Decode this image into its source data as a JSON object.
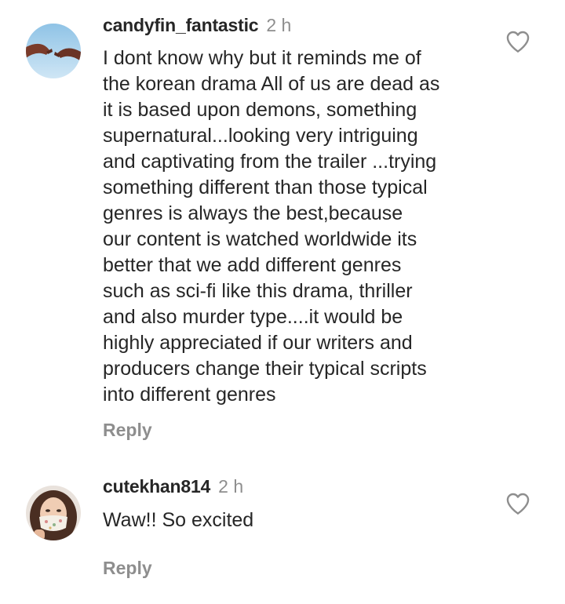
{
  "comments": [
    {
      "username": "candyfin_fantastic",
      "time": "2 h",
      "text": "I dont know why but it reminds me of\nthe korean drama All of us are dead as\nit is based upon demons, something\nsupernatural...looking very intriguing\nand captivating from the trailer ...trying\nsomething different than those typical\ngenres is always the best,because\nour content is watched worldwide its\nbetter that we add different genres\nsuch as sci-fi like this drama, thriller\nand also murder type....it would be\nhighly appreciated if our writers and\nproducers change their typical scripts\ninto different genres",
      "reply_label": "Reply",
      "avatar_icon": "hands-reaching-avatar",
      "like_icon": "heart-outline-icon"
    },
    {
      "username": "cutekhan814",
      "time": "2 h",
      "text": "Waw!! So excited",
      "reply_label": "Reply",
      "avatar_icon": "woman-with-mask-avatar",
      "like_icon": "heart-outline-icon"
    }
  ],
  "colors": {
    "text": "#262626",
    "secondary": "#8e8e8e",
    "background": "#ffffff"
  }
}
